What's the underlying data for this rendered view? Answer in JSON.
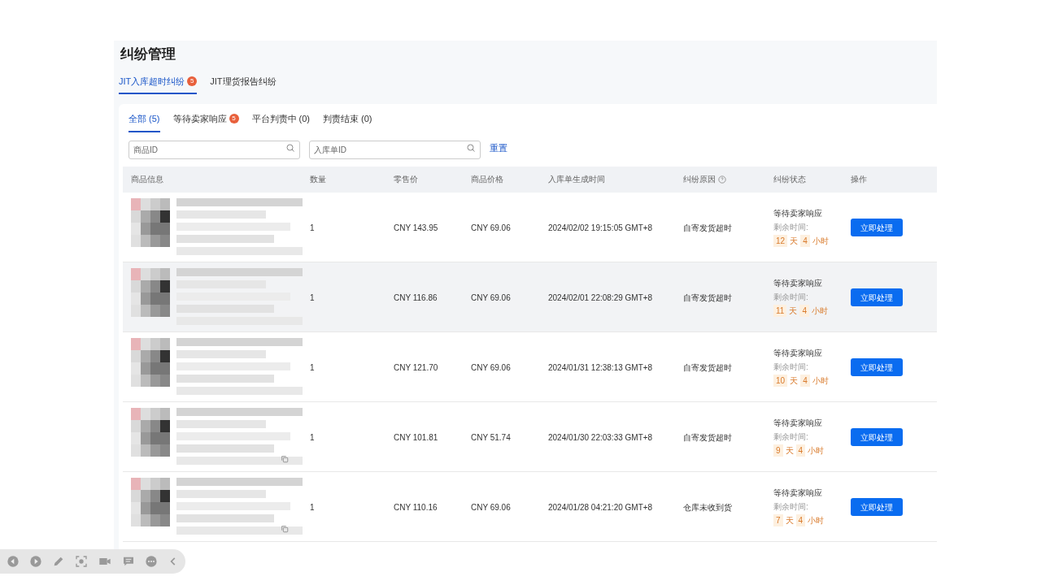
{
  "page_title": "纠纷管理",
  "top_tabs": [
    {
      "label": "JIT入库超时纠纷",
      "badge": "5",
      "selected": true
    },
    {
      "label": "JIT理货报告纠纷",
      "selected": false
    }
  ],
  "sub_tabs": [
    {
      "label": "全部 (5)",
      "selected": true
    },
    {
      "label": "等待卖家响应",
      "badge": "5",
      "selected": false
    },
    {
      "label": "平台判责中 (0)",
      "selected": false
    },
    {
      "label": "判责结束 (0)",
      "selected": false
    }
  ],
  "filters": [
    {
      "placeholder": "商品ID"
    },
    {
      "placeholder": "入库单ID"
    }
  ],
  "reset_link": "重置",
  "table": {
    "columns": [
      "商品信息",
      "数量",
      "零售价",
      "商品价格",
      "入库单生成时间",
      "纠纷原因",
      "纠纷状态",
      "操作"
    ],
    "rows": [
      {
        "quantity": "1",
        "retail_price": "CNY 143.95",
        "price": "CNY 69.06",
        "created": "2024/02/02 19:15:05 GMT+8",
        "reason": "自寄发货超时",
        "status": "等待卖家响应",
        "remaining_label": "剩余时间:",
        "days": "12",
        "day_unit": "天",
        "hours": "4",
        "hour_unit": "小时",
        "action": "立即处理",
        "highlighted": false,
        "copy_icon": false
      },
      {
        "quantity": "1",
        "retail_price": "CNY 116.86",
        "price": "CNY 69.06",
        "created": "2024/02/01 22:08:29 GMT+8",
        "reason": "自寄发货超时",
        "status": "等待卖家响应",
        "remaining_label": "剩余时间:",
        "days": "11",
        "day_unit": "天",
        "hours": "4",
        "hour_unit": "小时",
        "action": "立即处理",
        "highlighted": true,
        "copy_icon": false
      },
      {
        "quantity": "1",
        "retail_price": "CNY 121.70",
        "price": "CNY 69.06",
        "created": "2024/01/31 12:38:13 GMT+8",
        "reason": "自寄发货超时",
        "status": "等待卖家响应",
        "remaining_label": "剩余时间:",
        "days": "10",
        "day_unit": "天",
        "hours": "4",
        "hour_unit": "小时",
        "action": "立即处理",
        "highlighted": false,
        "copy_icon": false
      },
      {
        "quantity": "1",
        "retail_price": "CNY 101.81",
        "price": "CNY 51.74",
        "created": "2024/01/30 22:03:33 GMT+8",
        "reason": "自寄发货超时",
        "status": "等待卖家响应",
        "remaining_label": "剩余时间:",
        "days": "9",
        "day_unit": "天",
        "hours": "4",
        "hour_unit": "小时",
        "action": "立即处理",
        "highlighted": false,
        "copy_icon": true
      },
      {
        "quantity": "1",
        "retail_price": "CNY 110.16",
        "price": "CNY 69.06",
        "created": "2024/01/28 04:21:20 GMT+8",
        "reason": "仓库未收到货",
        "status": "等待卖家响应",
        "remaining_label": "剩余时间:",
        "days": "7",
        "day_unit": "天",
        "hours": "4",
        "hour_unit": "小时",
        "action": "立即处理",
        "highlighted": false,
        "copy_icon": true
      }
    ]
  }
}
